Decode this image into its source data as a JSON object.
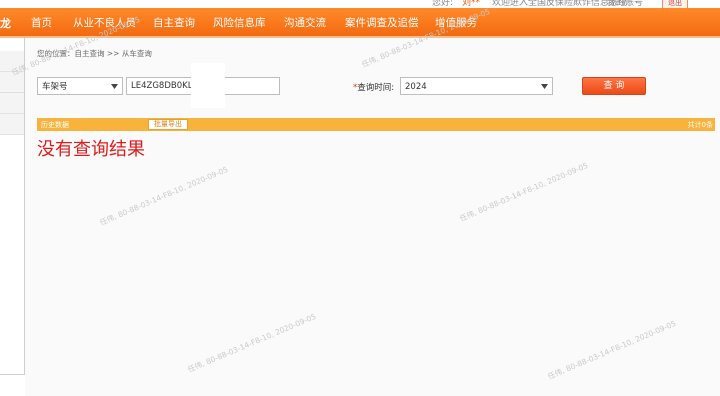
{
  "topbar": {
    "greeting_prefix": "您好:",
    "username": "刘**",
    "welcome": "欢迎进入全国反保险欺诈信息系统",
    "account": "我的账号",
    "logout": "退出"
  },
  "nav": {
    "left_cut": "龙",
    "items": [
      "首页",
      "从业不良人员",
      "自主查询",
      "风险信息库",
      "沟通交流",
      "案件调查及追偿",
      "增值服务"
    ]
  },
  "breadcrumb": "您的位置：自主查询 >> 从车查询",
  "search": {
    "type_value": "车架号",
    "vin_value": "LE4ZG8DB0KL3",
    "time_label": "查询时间:",
    "year_value": "2024",
    "query_button": "查 询"
  },
  "results_bar": {
    "history_label": "历史数据",
    "export_button": "批量导出",
    "total": "共计0条"
  },
  "no_result_text": "没有查询结果",
  "watermark": "任伟, 80-88-03-14-F8-10, 2020-09-05",
  "colors": {
    "nav": "#f46a10",
    "accent_bar": "#f7b33b",
    "button": "#f55d2a",
    "error": "#e01b1b"
  }
}
